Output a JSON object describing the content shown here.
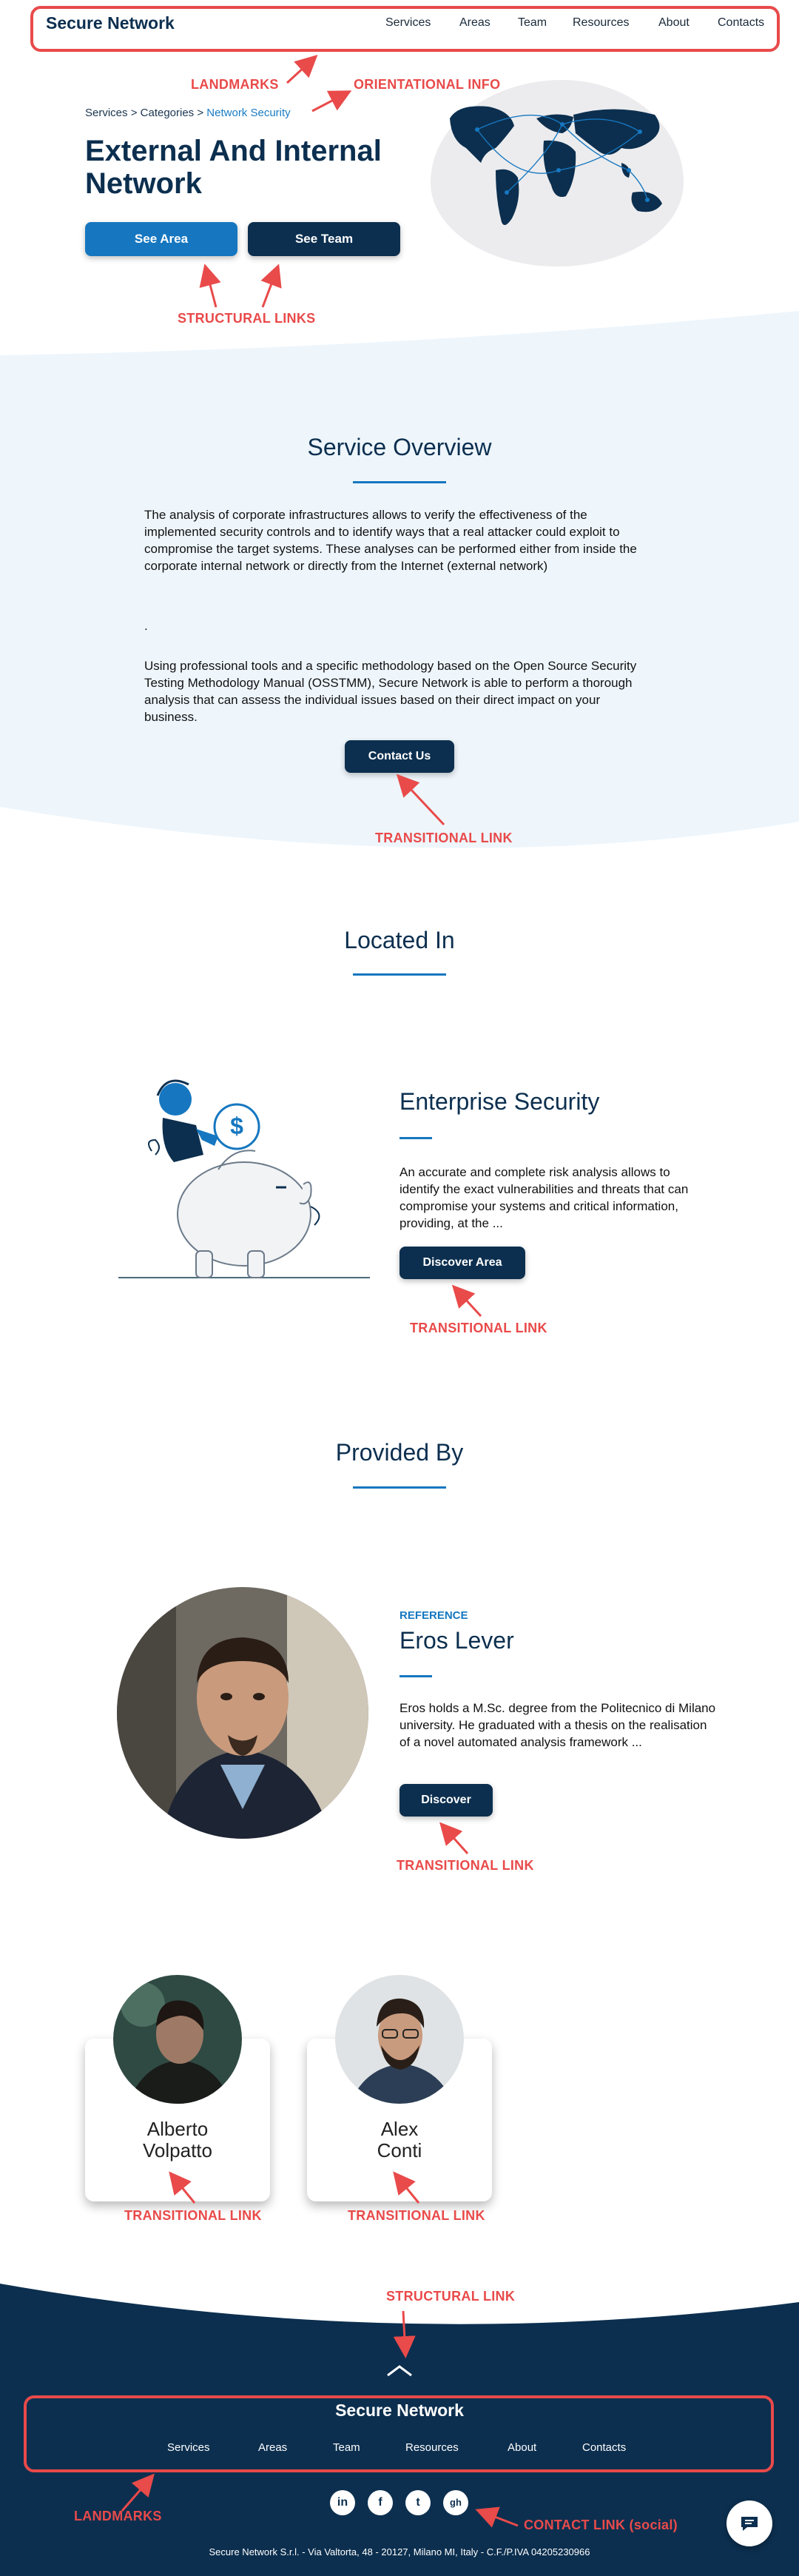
{
  "header": {
    "brand": "Secure Network",
    "nav": [
      "Services",
      "Areas",
      "Team",
      "Resources",
      "About",
      "Contacts"
    ]
  },
  "annotations": {
    "landmarks_top": "LANDMARKS",
    "orientational": "ORIENTATIONAL INFO",
    "structural_hero": "STRUCTURAL LINKS",
    "transitional_contact": "TRANSITIONAL LINK",
    "transitional_area": "TRANSITIONAL LINK",
    "transitional_discover": "TRANSITIONAL LINK",
    "transitional_card1": "TRANSITIONAL LINK",
    "transitional_card2": "TRANSITIONAL LINK",
    "structural_footer": "STRUCTURAL LINK",
    "landmarks_footer": "LANDMARKS",
    "contact_social": "CONTACT LINK (social)"
  },
  "hero": {
    "breadcrumb": [
      "Services",
      "Categories",
      "Network Security"
    ],
    "breadcrumb_sep": ">",
    "title": "External And Internal Network",
    "btn_area": "See Area",
    "btn_team": "See Team"
  },
  "overview": {
    "title": "Service Overview",
    "para1": "The analysis of corporate infrastructures allows to verify the effectiveness of the implemented security controls and to identify ways that a real attacker could exploit to compromise the target systems. These analyses can be performed either from inside the corporate internal network or directly from the Internet (external network)",
    "dot": ".",
    "para2": "Using professional tools and a specific methodology based on the Open Source Security Testing Methodology Manual (OSSTMM), Secure Network is able to perform a thorough analysis that can assess the individual issues based on their direct impact on your business.",
    "cta": "Contact Us"
  },
  "located": {
    "title": "Located In",
    "area_title": "Enterprise Security",
    "area_text": "An accurate and complete risk analysis allows to identify the exact vulnerabilities and threats that can compromise your systems and critical information, providing, at the ...",
    "area_btn": "Discover Area",
    "coin_symbol": "$"
  },
  "provided": {
    "title": "Provided By",
    "ref_label": "REFERENCE",
    "ref_name": "Eros Lever",
    "ref_text": "Eros holds a M.Sc. degree from the Politecnico di Milano university. He graduated with a thesis on the realisation of a novel automated analysis framework ...",
    "ref_btn": "Discover",
    "cards": [
      {
        "first": "Alberto",
        "last": "Volpatto"
      },
      {
        "first": "Alex",
        "last": "Conti"
      }
    ]
  },
  "footer": {
    "brand": "Secure Network",
    "nav": [
      "Services",
      "Areas",
      "Team",
      "Resources",
      "About",
      "Contacts"
    ],
    "social_icons": [
      "linkedin-icon",
      "facebook-icon",
      "twitter-icon",
      "github-icon"
    ],
    "social_glyphs": [
      "in",
      "f",
      "t",
      "gh"
    ],
    "legal": "Secure Network S.r.l. - Via Valtorta, 48 - 20127, Milano MI, Italy - C.F./P.IVA 04205230966"
  },
  "colors": {
    "navy": "#0c2f4f",
    "accent_blue": "#1677c0",
    "annotation_red": "#e94a4a",
    "band_light": "#eef6fc"
  }
}
